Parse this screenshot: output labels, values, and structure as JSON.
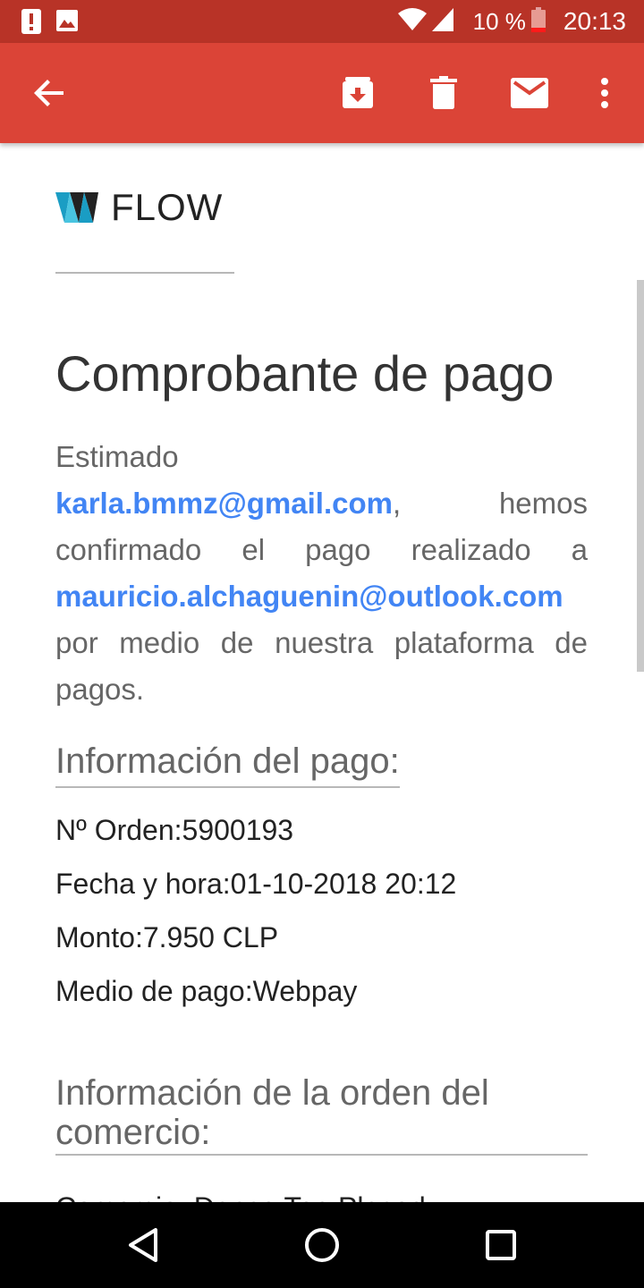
{
  "status_bar": {
    "battery_percent": "10 %",
    "time": "20:13",
    "icons": [
      "alert-icon",
      "image-icon",
      "wifi-icon",
      "signal-icon",
      "battery-low-icon"
    ]
  },
  "app_bar": {
    "icons": [
      "back-arrow-icon",
      "archive-icon",
      "delete-icon",
      "mail-icon",
      "more-vert-icon"
    ],
    "color": "#db4437"
  },
  "email": {
    "logo_text": "FLOW",
    "title": "Comprobante de pago",
    "intro": {
      "greeting": "Estimado",
      "payer_email": "karla.bmmz@gmail.com",
      "comma": ",",
      "text1": "hemos confirmado el pago realizado a",
      "payee_email": "mauricio.alchaguenin@outlook.com",
      "text2": "por medio de nuestra plataforma de pagos."
    },
    "payment_info": {
      "heading": "Información del pago:",
      "rows": [
        {
          "label": "Nº Orden:",
          "value": "5900193"
        },
        {
          "label": "Fecha y hora:",
          "value": "01-10-2018 20:12"
        },
        {
          "label": "Monto:",
          "value": "7.950 CLP"
        },
        {
          "label": "Medio de pago:",
          "value": "Webpay"
        }
      ]
    },
    "order_info": {
      "heading": "Información de la orden del comercio:",
      "partial_line": "Comercio: Dance Tea Placed..."
    },
    "link_color": "#4285f4"
  }
}
